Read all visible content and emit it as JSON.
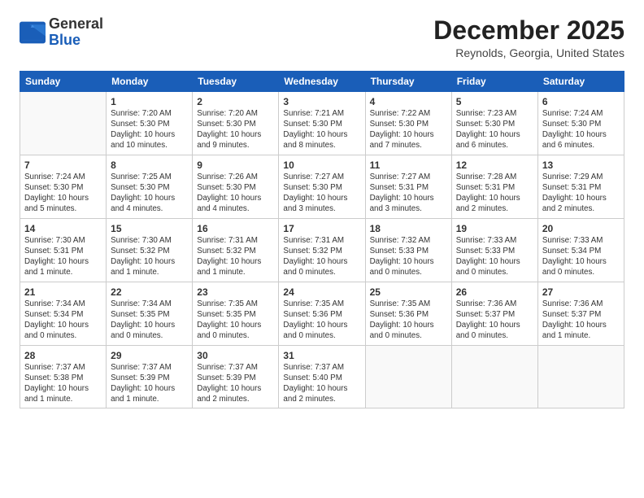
{
  "header": {
    "logo_general": "General",
    "logo_blue": "Blue",
    "month_title": "December 2025",
    "location": "Reynolds, Georgia, United States"
  },
  "columns": [
    "Sunday",
    "Monday",
    "Tuesday",
    "Wednesday",
    "Thursday",
    "Friday",
    "Saturday"
  ],
  "weeks": [
    [
      {
        "day": "",
        "info": ""
      },
      {
        "day": "1",
        "info": "Sunrise: 7:20 AM\nSunset: 5:30 PM\nDaylight: 10 hours\nand 10 minutes."
      },
      {
        "day": "2",
        "info": "Sunrise: 7:20 AM\nSunset: 5:30 PM\nDaylight: 10 hours\nand 9 minutes."
      },
      {
        "day": "3",
        "info": "Sunrise: 7:21 AM\nSunset: 5:30 PM\nDaylight: 10 hours\nand 8 minutes."
      },
      {
        "day": "4",
        "info": "Sunrise: 7:22 AM\nSunset: 5:30 PM\nDaylight: 10 hours\nand 7 minutes."
      },
      {
        "day": "5",
        "info": "Sunrise: 7:23 AM\nSunset: 5:30 PM\nDaylight: 10 hours\nand 6 minutes."
      },
      {
        "day": "6",
        "info": "Sunrise: 7:24 AM\nSunset: 5:30 PM\nDaylight: 10 hours\nand 6 minutes."
      }
    ],
    [
      {
        "day": "7",
        "info": "Sunrise: 7:24 AM\nSunset: 5:30 PM\nDaylight: 10 hours\nand 5 minutes."
      },
      {
        "day": "8",
        "info": "Sunrise: 7:25 AM\nSunset: 5:30 PM\nDaylight: 10 hours\nand 4 minutes."
      },
      {
        "day": "9",
        "info": "Sunrise: 7:26 AM\nSunset: 5:30 PM\nDaylight: 10 hours\nand 4 minutes."
      },
      {
        "day": "10",
        "info": "Sunrise: 7:27 AM\nSunset: 5:30 PM\nDaylight: 10 hours\nand 3 minutes."
      },
      {
        "day": "11",
        "info": "Sunrise: 7:27 AM\nSunset: 5:31 PM\nDaylight: 10 hours\nand 3 minutes."
      },
      {
        "day": "12",
        "info": "Sunrise: 7:28 AM\nSunset: 5:31 PM\nDaylight: 10 hours\nand 2 minutes."
      },
      {
        "day": "13",
        "info": "Sunrise: 7:29 AM\nSunset: 5:31 PM\nDaylight: 10 hours\nand 2 minutes."
      }
    ],
    [
      {
        "day": "14",
        "info": "Sunrise: 7:30 AM\nSunset: 5:31 PM\nDaylight: 10 hours\nand 1 minute."
      },
      {
        "day": "15",
        "info": "Sunrise: 7:30 AM\nSunset: 5:32 PM\nDaylight: 10 hours\nand 1 minute."
      },
      {
        "day": "16",
        "info": "Sunrise: 7:31 AM\nSunset: 5:32 PM\nDaylight: 10 hours\nand 1 minute."
      },
      {
        "day": "17",
        "info": "Sunrise: 7:31 AM\nSunset: 5:32 PM\nDaylight: 10 hours\nand 0 minutes."
      },
      {
        "day": "18",
        "info": "Sunrise: 7:32 AM\nSunset: 5:33 PM\nDaylight: 10 hours\nand 0 minutes."
      },
      {
        "day": "19",
        "info": "Sunrise: 7:33 AM\nSunset: 5:33 PM\nDaylight: 10 hours\nand 0 minutes."
      },
      {
        "day": "20",
        "info": "Sunrise: 7:33 AM\nSunset: 5:34 PM\nDaylight: 10 hours\nand 0 minutes."
      }
    ],
    [
      {
        "day": "21",
        "info": "Sunrise: 7:34 AM\nSunset: 5:34 PM\nDaylight: 10 hours\nand 0 minutes."
      },
      {
        "day": "22",
        "info": "Sunrise: 7:34 AM\nSunset: 5:35 PM\nDaylight: 10 hours\nand 0 minutes."
      },
      {
        "day": "23",
        "info": "Sunrise: 7:35 AM\nSunset: 5:35 PM\nDaylight: 10 hours\nand 0 minutes."
      },
      {
        "day": "24",
        "info": "Sunrise: 7:35 AM\nSunset: 5:36 PM\nDaylight: 10 hours\nand 0 minutes."
      },
      {
        "day": "25",
        "info": "Sunrise: 7:35 AM\nSunset: 5:36 PM\nDaylight: 10 hours\nand 0 minutes."
      },
      {
        "day": "26",
        "info": "Sunrise: 7:36 AM\nSunset: 5:37 PM\nDaylight: 10 hours\nand 0 minutes."
      },
      {
        "day": "27",
        "info": "Sunrise: 7:36 AM\nSunset: 5:37 PM\nDaylight: 10 hours\nand 1 minute."
      }
    ],
    [
      {
        "day": "28",
        "info": "Sunrise: 7:37 AM\nSunset: 5:38 PM\nDaylight: 10 hours\nand 1 minute."
      },
      {
        "day": "29",
        "info": "Sunrise: 7:37 AM\nSunset: 5:39 PM\nDaylight: 10 hours\nand 1 minute."
      },
      {
        "day": "30",
        "info": "Sunrise: 7:37 AM\nSunset: 5:39 PM\nDaylight: 10 hours\nand 2 minutes."
      },
      {
        "day": "31",
        "info": "Sunrise: 7:37 AM\nSunset: 5:40 PM\nDaylight: 10 hours\nand 2 minutes."
      },
      {
        "day": "",
        "info": ""
      },
      {
        "day": "",
        "info": ""
      },
      {
        "day": "",
        "info": ""
      }
    ]
  ]
}
